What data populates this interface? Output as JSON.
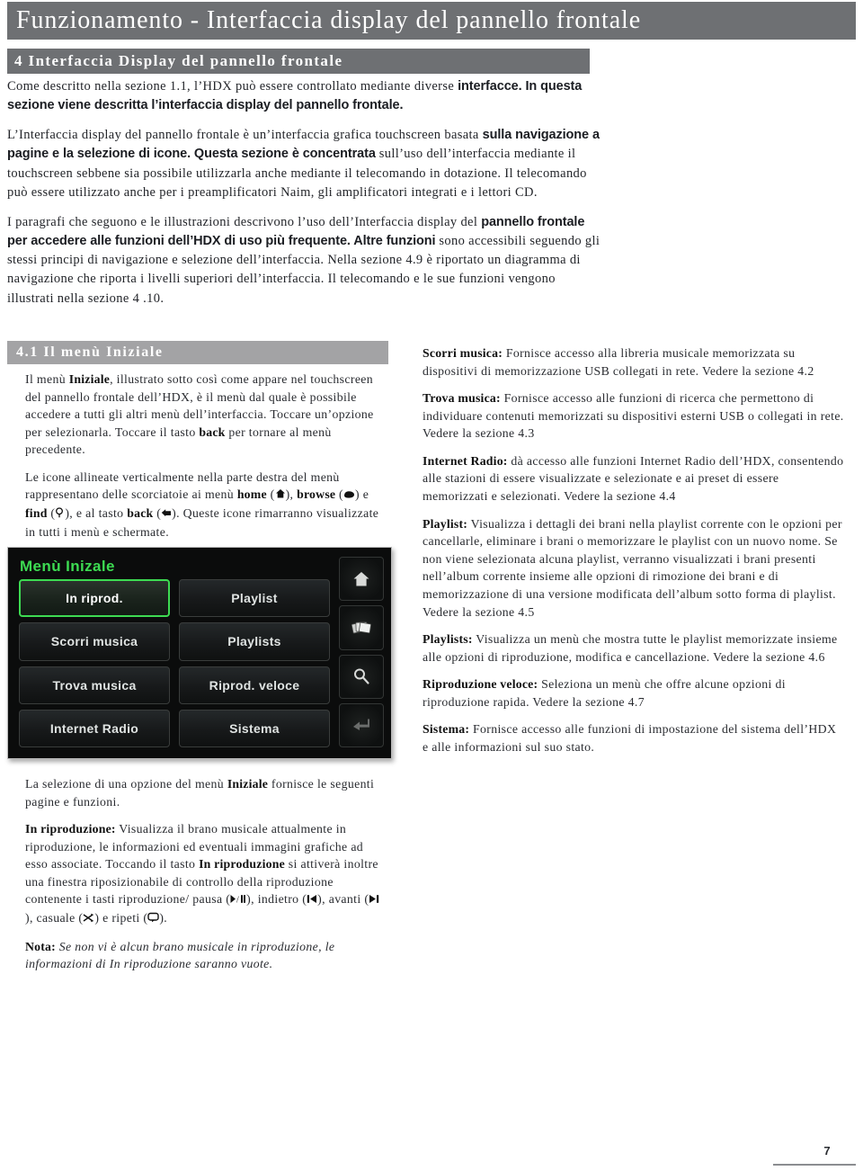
{
  "header": {
    "title": "Funzionamento - Interfaccia display del pannello frontale"
  },
  "section": {
    "number_title": "4 Interfaccia Display del pannello frontale"
  },
  "intro": {
    "p1_part1": "Come descritto nella sezione 1.1, l’HDX può essere controllato mediante diverse ",
    "p1_part2": "interfacce. In questa sezione viene descritta l’interfaccia display del pannello frontale.",
    "p2_part1": "L’Interfaccia display del pannello frontale è un’interfaccia grafica touchscreen basata ",
    "p2_part2": "sulla navigazione a pagine e la selezione di icone. Questa sezione è concentrata ",
    "p2_part3": "sull’uso dell’interfaccia mediante il touchscreen sebbene sia possibile utilizzarla anche mediante il telecomando in dotazione. Il telecomando può essere utilizzato anche per i preamplificatori Naim, gli amplificatori integrati e i lettori CD.",
    "p3_part1": "I paragrafi che seguono e le illustrazioni descrivono l’uso dell’Interfaccia display del ",
    "p3_part2": "pannello frontale per accedere alle funzioni dell’HDX di uso più frequente. Altre funzioni ",
    "p3_part3": "sono accessibili seguendo gli stessi principi di navigazione e selezione dell’interfaccia. Nella sezione 4.9 è riportato un diagramma di navigazione che riporta i livelli superiori dell’interfaccia. Il telecomando e le sue funzioni vengono illustrati nella sezione 4 .10."
  },
  "subsection": {
    "number_title": "4.1 Il menù Iniziale"
  },
  "left_column": {
    "p1_a": "Il menù ",
    "p1_b": "Iniziale",
    "p1_c": ", illustrato sotto così come appare nel touchscreen del pannello frontale dell’HDX, è il menù dal quale è possibile accedere a tutti gli altri menù dell’interfaccia. Toccare un’opzione per selezionarla. Toccare il tasto ",
    "p1_d": "back",
    "p1_e": " per tornare al menù precedente.",
    "p2_a": "Le icone allineate verticalmente nella parte destra del menù rappresentano delle scorciatoie ai menù ",
    "p2_home": "home",
    "p2_b": " (",
    "p2_c": "), ",
    "p2_browse": "browse",
    "p2_d": " (",
    "p2_e": ") e ",
    "p2_find": "find",
    "p2_f": " (",
    "p2_g": "), e al tasto ",
    "p2_back": "back",
    "p2_h": " (",
    "p2_i": "). Queste icone rimarranno visualizzate in tutti i menù e schermate.",
    "p3_a": "La selezione di una opzione del menù ",
    "p3_b": "Iniziale",
    "p3_c": " fornisce le seguenti pagine e funzioni.",
    "p4_b": "In riproduzione:",
    "p4_a": " Visualizza il brano musicale attualmente in riproduzione, le informazioni ed eventuali immagini grafiche ad esso associate. Toccando il tasto ",
    "p4_bold2": "In riproduzione",
    "p4_c": " si attiverà inoltre una finestra riposizionabile di controllo della riproduzione contenente i tasti riproduzione/ pausa (",
    "p4_d": "), indietro (",
    "p4_e": "), avanti (",
    "p4_f": "), casuale (",
    "p4_g": ") e ripeti (",
    "p4_h": ").",
    "note_label": "Nota:",
    "note_text": " Se non vi è alcun brano musicale in riproduzione, le informazioni di In riproduzione saranno vuote."
  },
  "right_column": {
    "items": [
      {
        "term": "Scorri musica:",
        "text": " Fornisce accesso alla libreria musicale memorizzata su dispositivi di memorizzazione USB collegati in rete. Vedere la sezione 4.2"
      },
      {
        "term": "Trova musica:",
        "text": " Fornisce accesso alle funzioni di ricerca che permettono di individuare contenuti memorizzati su dispositivi esterni USB o collegati in rete. Vedere la sezione 4.3"
      },
      {
        "term": "Internet Radio:",
        "text": " dà accesso alle funzioni Internet Radio dell’HDX, consentendo alle stazioni di essere visualizzate e selezionate e ai preset di essere memorizzati e selezionati. Vedere la sezione 4.4"
      },
      {
        "term": "Playlist:",
        "text": " Visualizza i dettagli dei brani nella playlist corrente con le opzioni per cancellarle, eliminare i brani o memorizzare le playlist con un nuovo nome. Se non viene selezionata alcuna playlist, verranno visualizzati i brani presenti nell’album corrente insieme alle opzioni di rimozione dei brani e di memorizzazione di una versione modificata dell’album sotto forma di playlist. Vedere la sezione 4.5"
      },
      {
        "term": "Playlists:",
        "text": " Visualizza un menù che mostra tutte le playlist memorizzate insieme alle opzioni di riproduzione, modifica e cancellazione. Vedere la sezione 4.6"
      },
      {
        "term": "Riproduzione veloce:",
        "text": " Seleziona un menù che offre alcune opzioni di riproduzione rapida. Vedere la sezione 4.7"
      },
      {
        "term": "Sistema:",
        "text": " Fornisce accesso alle funzioni di impostazione del sistema dell’HDX e alle informazioni sul suo stato."
      }
    ]
  },
  "device": {
    "title": "Menù Inizale",
    "buttons": [
      {
        "label": "In riprod.",
        "selected": true
      },
      {
        "label": "Playlist",
        "selected": false
      },
      {
        "label": "Scorri musica",
        "selected": false
      },
      {
        "label": "Playlists",
        "selected": false
      },
      {
        "label": "Trova musica",
        "selected": false
      },
      {
        "label": "Riprod. veloce",
        "selected": false
      },
      {
        "label": "Internet Radio",
        "selected": false
      },
      {
        "label": "Sistema",
        "selected": false
      }
    ],
    "sidebar_icons": [
      "home-icon",
      "browse-icon",
      "find-icon",
      "back-icon"
    ],
    "accent_color": "#3ddb52",
    "screen_bg": "#0b0c0c"
  },
  "footer": {
    "page_number": "7"
  },
  "colors": {
    "header_bar": "#6e7073",
    "subsection_bar": "#a3a3a5"
  }
}
